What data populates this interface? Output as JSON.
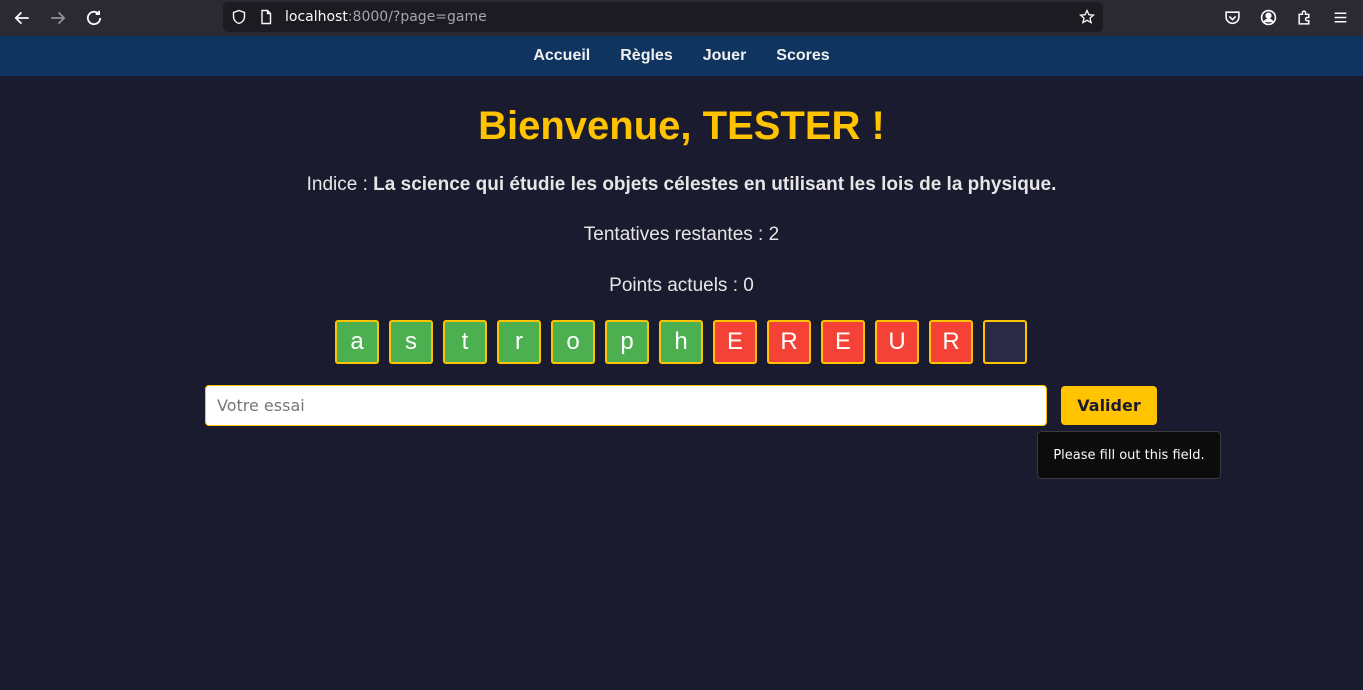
{
  "browser": {
    "url_host": "localhost",
    "url_rest": ":8000/?page=game",
    "icons": [
      "back-arrow-icon",
      "forward-arrow-icon",
      "reload-icon",
      "shield-icon",
      "page-icon",
      "bookmark-star-icon",
      "pocket-icon",
      "account-icon",
      "extensions-icon",
      "menu-icon"
    ]
  },
  "nav": {
    "items": [
      {
        "label": "Accueil"
      },
      {
        "label": "Règles"
      },
      {
        "label": "Jouer"
      },
      {
        "label": "Scores"
      }
    ]
  },
  "game": {
    "title": "Bienvenue, TESTER !",
    "hint_label": "Indice : ",
    "hint_text": "La science qui étudie les objets célestes en utilisant les lois de la physique.",
    "attempts": "Tentatives restantes : 2",
    "points": "Points actuels : 0",
    "tiles": [
      {
        "letter": "a",
        "status": "correct"
      },
      {
        "letter": "s",
        "status": "correct"
      },
      {
        "letter": "t",
        "status": "correct"
      },
      {
        "letter": "r",
        "status": "correct"
      },
      {
        "letter": "o",
        "status": "correct"
      },
      {
        "letter": "p",
        "status": "correct"
      },
      {
        "letter": "h",
        "status": "correct"
      },
      {
        "letter": "E",
        "status": "wrong"
      },
      {
        "letter": "R",
        "status": "wrong"
      },
      {
        "letter": "E",
        "status": "wrong"
      },
      {
        "letter": "U",
        "status": "wrong"
      },
      {
        "letter": "R",
        "status": "wrong"
      },
      {
        "letter": "",
        "status": "empty"
      }
    ],
    "input_placeholder": "Votre essai",
    "input_value": "",
    "submit_label": "Valider",
    "tooltip": "Please fill out this field."
  },
  "colors": {
    "background": "#1b1b2f",
    "nav_bg": "#0f3460",
    "accent": "#ffc300",
    "correct": "#4caf50",
    "wrong": "#f44336"
  }
}
